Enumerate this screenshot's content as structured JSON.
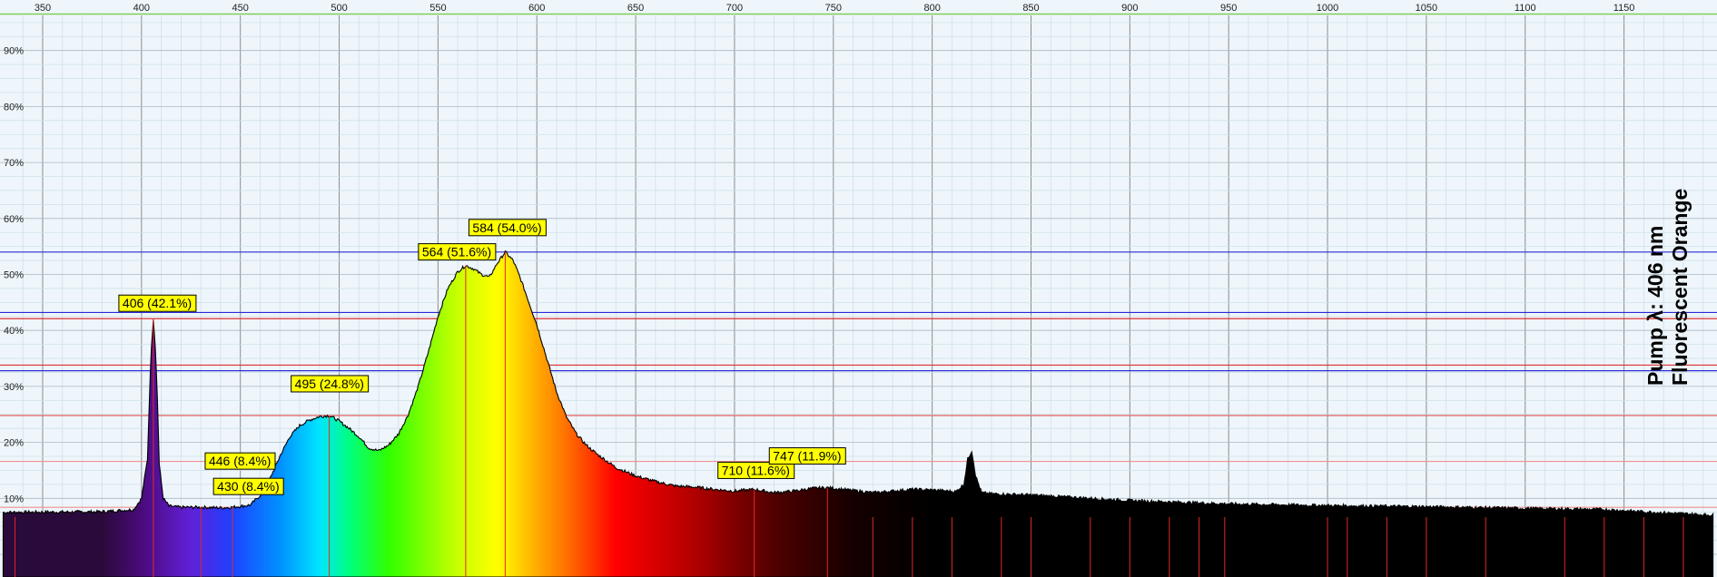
{
  "chart_data": {
    "type": "area",
    "xlim": [
      330,
      1195
    ],
    "ylim": [
      0,
      100
    ],
    "x_ticks": [
      350,
      400,
      450,
      500,
      550,
      600,
      650,
      700,
      750,
      800,
      850,
      900,
      950,
      1000,
      1050,
      1100,
      1150
    ],
    "x_tick_labels": [
      "350",
      "400",
      "450",
      "500",
      "550",
      "600",
      "650",
      "700",
      "750",
      "800",
      "850",
      "900",
      "950",
      "1000",
      "1050",
      "1100",
      "1150"
    ],
    "y_ticks": [
      10,
      20,
      30,
      40,
      50,
      60,
      70,
      80,
      90
    ],
    "y_tick_labels": [
      "10%",
      "20%",
      "30%",
      "40%",
      "50%",
      "60%",
      "70%",
      "80%",
      "90%"
    ],
    "grid": true,
    "text_block": [
      "Pump λ: 406 nm",
      "Fluorescent Orange"
    ],
    "series": [
      {
        "x": [
          330,
          380,
          396,
          400,
          403,
          404,
          405,
          406,
          407,
          408,
          409,
          411,
          414,
          420,
          430,
          440,
          446,
          455,
          460,
          465,
          470,
          475,
          480,
          485,
          490,
          495,
          500,
          505,
          510,
          515,
          520,
          525,
          530,
          535,
          540,
          545,
          550,
          555,
          560,
          564,
          568,
          572,
          576,
          580,
          584,
          588,
          592,
          596,
          600,
          605,
          610,
          615,
          620,
          625,
          630,
          640,
          650,
          660,
          670,
          680,
          690,
          700,
          710,
          720,
          730,
          740,
          747,
          760,
          770,
          780,
          790,
          800,
          812,
          816,
          818,
          820,
          822,
          825,
          830,
          850,
          870,
          890,
          900,
          950,
          1000,
          1050,
          1100,
          1140,
          1160,
          1195
        ],
        "y": [
          7.5,
          7.6,
          8.0,
          10.0,
          17.0,
          28.0,
          37.0,
          42.1,
          37.0,
          28.0,
          16.0,
          10.0,
          8.6,
          8.4,
          8.4,
          8.3,
          8.4,
          8.8,
          10.5,
          13.5,
          17.5,
          21.0,
          23.0,
          24.0,
          24.6,
          24.8,
          23.8,
          22.5,
          21.0,
          19.0,
          18.5,
          19.5,
          21.5,
          25.0,
          30.0,
          36.0,
          42.5,
          47.5,
          50.5,
          51.6,
          51.0,
          50.0,
          49.5,
          52.0,
          54.0,
          52.5,
          49.0,
          45.0,
          41.0,
          35.0,
          29.0,
          24.5,
          21.5,
          19.5,
          18.0,
          15.5,
          14.0,
          13.0,
          12.2,
          12.0,
          11.6,
          11.3,
          11.6,
          11.0,
          11.3,
          11.8,
          11.9,
          11.4,
          11.0,
          11.3,
          11.6,
          11.5,
          11.2,
          12.5,
          17.0,
          18.5,
          14.0,
          11.0,
          10.8,
          10.6,
          10.2,
          9.8,
          9.6,
          9.0,
          8.7,
          8.5,
          8.2,
          8.0,
          7.6,
          7.0
        ]
      }
    ],
    "peaks": [
      {
        "x": 406,
        "y": 42.1,
        "label": "406 (42.1%)"
      },
      {
        "x": 430,
        "y": 8.4,
        "label": "430 (8.4%)"
      },
      {
        "x": 446,
        "y": 8.4,
        "label": "446 (8.4%)"
      },
      {
        "x": 495,
        "y": 24.8,
        "label": "495 (24.8%)"
      },
      {
        "x": 564,
        "y": 51.6,
        "label": "564 (51.6%)"
      },
      {
        "x": 584,
        "y": 54.0,
        "label": "584 (54.0%)"
      },
      {
        "x": 710,
        "y": 11.6,
        "label": "710 (11.6%)"
      },
      {
        "x": 747,
        "y": 11.9,
        "label": "747 (11.9%)"
      }
    ],
    "h_lines": [
      {
        "y": 54.0,
        "color": "#2b2bd6"
      },
      {
        "y": 43.2,
        "color": "#2b2bd6"
      },
      {
        "y": 42.1,
        "color": "#e03030"
      },
      {
        "y": 33.8,
        "color": "#e03030"
      },
      {
        "y": 32.8,
        "color": "#2b2bd6"
      },
      {
        "y": 24.8,
        "color": "#e86060"
      },
      {
        "y": 16.6,
        "color": "#f09090"
      },
      {
        "y": 8.4,
        "color": "#f09090"
      }
    ],
    "v_markers": [
      336,
      406,
      430,
      446,
      495,
      564,
      584,
      710,
      747,
      770,
      790,
      810,
      835,
      850,
      880,
      900,
      920,
      935,
      948,
      1000,
      1010,
      1030,
      1050,
      1080,
      1120,
      1140,
      1160,
      1180
    ],
    "colors": {
      "background": "#eef6fb",
      "major_grid": "#8c8c8c",
      "minor_grid": "#cfe0ea",
      "label_fill": "#ffff00"
    }
  }
}
